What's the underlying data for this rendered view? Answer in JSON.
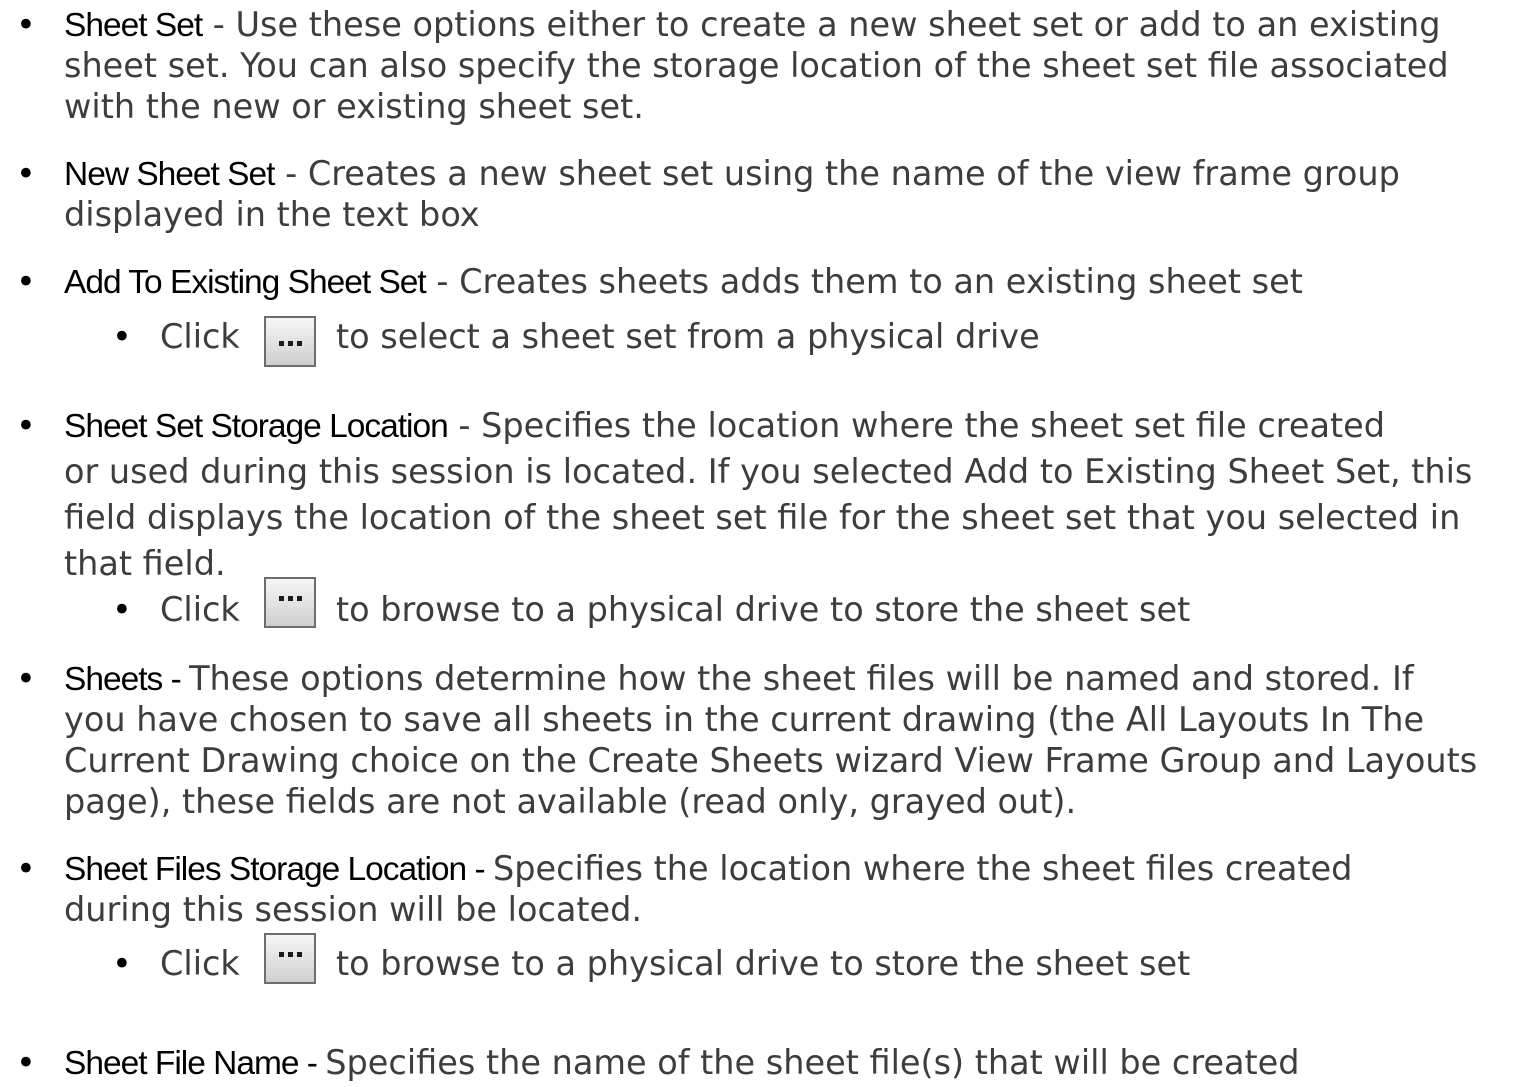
{
  "items": [
    {
      "term": "Sheet Set",
      "lines": [
        " - Use these options either to create a new sheet set or add to an existing",
        "sheet set. You can also specify the storage location of the sheet set file associated",
        "with the new or existing sheet set."
      ]
    },
    {
      "term": "New Sheet Set",
      "lines": [
        " - Creates a new sheet set using the name of the view frame group",
        "displayed in the text box"
      ]
    },
    {
      "term": "Add To Existing Sheet Set",
      "lines": [
        " - Creates sheets adds them to an existing sheet set"
      ]
    },
    {
      "term": "Sheet Set Storage Location",
      "lines": [
        " - Specifies the location where the sheet set file created",
        "or used during this session is located. If you selected Add to Existing Sheet Set, this",
        "field displays the location of the sheet set file for the sheet set that you selected in",
        "that field."
      ]
    },
    {
      "term": "Sheets - ",
      "lines": [
        "These options determine how the sheet files will be named and stored. If",
        "you have chosen to save all sheets in the current drawing (the All Layouts In The",
        "Current Drawing choice on the Create Sheets wizard View Frame Group and Layouts",
        "page), these fields are not available (read only, grayed out)."
      ]
    },
    {
      "term": "Sheet Files Storage Location - ",
      "lines": [
        "Specifies the location where the sheet files created",
        "during this session will be located."
      ]
    },
    {
      "term": "Sheet File Name - ",
      "lines": [
        "Specifies the name of the sheet file(s) that will be created"
      ]
    }
  ],
  "subs": [
    {
      "click": "Click",
      "rest": "to select a sheet set from a physical drive"
    },
    {
      "click": "Click",
      "rest": "to browse to a physical drive to store the sheet set"
    },
    {
      "click": "Click",
      "rest": "to browse to a physical drive to store the sheet set"
    }
  ],
  "bullet_char": "•"
}
